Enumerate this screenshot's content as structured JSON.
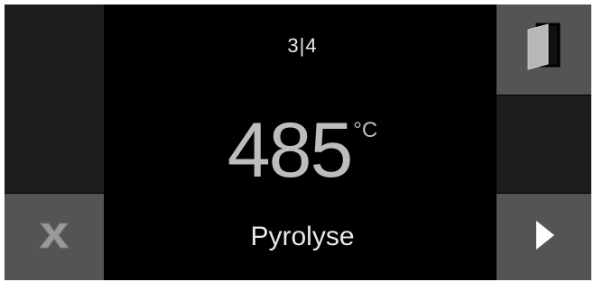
{
  "header": {
    "step_indicator": "3|4"
  },
  "main": {
    "temperature_value": "485",
    "temperature_unit": "°C",
    "program_name": "Pyrolyse"
  },
  "buttons": {
    "door": {
      "icon": "door-icon"
    },
    "cancel": {
      "icon": "x-icon"
    },
    "next": {
      "icon": "play-arrow-icon"
    }
  },
  "colors": {
    "screen_background": "#000000",
    "button_background": "#545454",
    "side_panel": "#1d1d1d",
    "text_primary": "#e8e8e8",
    "text_secondary": "#bdbdbd"
  }
}
